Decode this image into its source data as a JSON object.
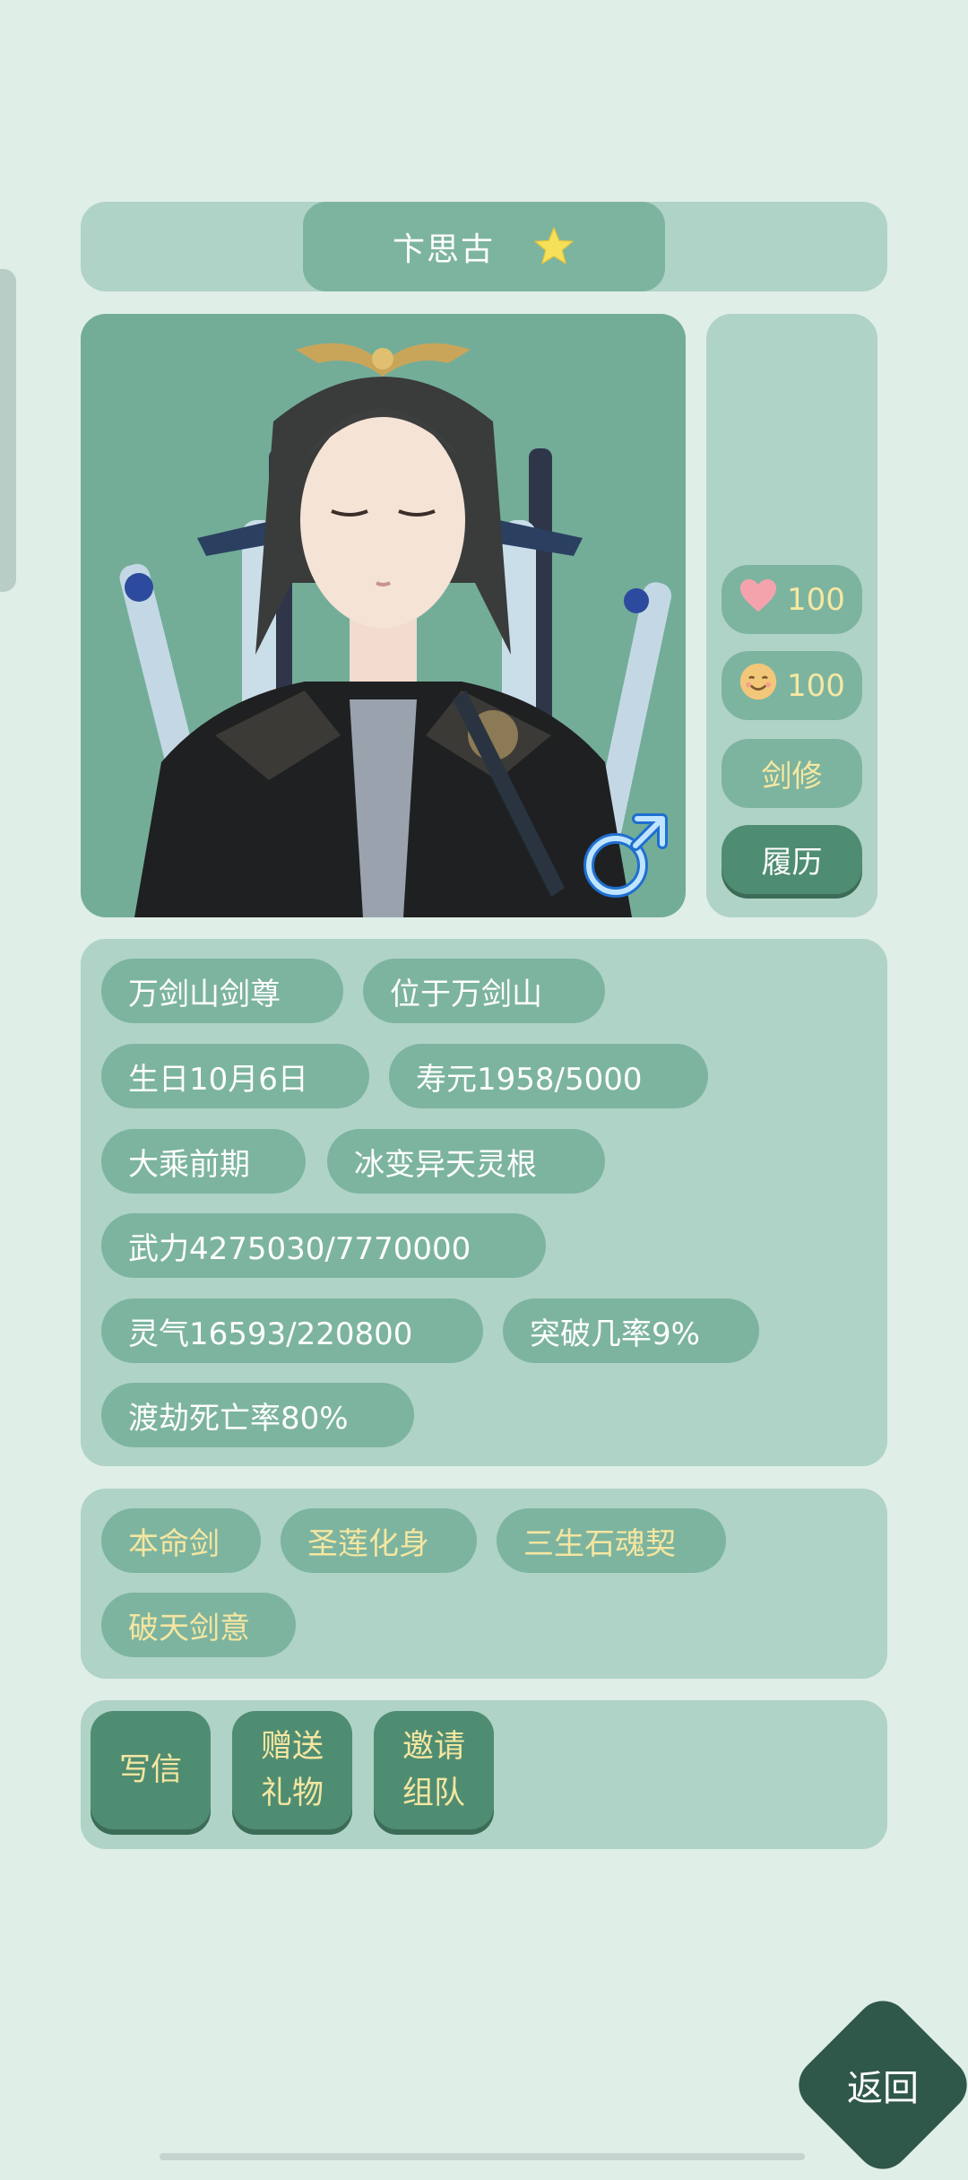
{
  "character": {
    "name": "卞思古",
    "favorite_icon": "star-icon",
    "gender_icon": "male-symbol-icon"
  },
  "side": {
    "affection": {
      "icon": "heart-icon",
      "value": "100"
    },
    "mood": {
      "icon": "smiling-face-icon",
      "value": "100"
    },
    "profession": "剑修",
    "history_button": "履历"
  },
  "info_tags": [
    "万剑山剑尊",
    "位于万剑山",
    "生日10月6日",
    "寿元1958/5000",
    "大乘前期",
    "冰变异天灵根",
    "武力4275030/7770000",
    "灵气16593/220800",
    "突破几率9%",
    "渡劫死亡率80%"
  ],
  "trait_tags": [
    "本命剑",
    "圣莲化身",
    "三生石魂契",
    "破天剑意"
  ],
  "actions": [
    "写信",
    "赠送\n礼物",
    "邀请\n组队"
  ],
  "back_button": "返回",
  "colors": {
    "background": "#dfeee7",
    "panel": "#afd3c7",
    "chip": "#7db49f",
    "button": "#4f8d72",
    "gold_text": "#f5e6a0"
  }
}
